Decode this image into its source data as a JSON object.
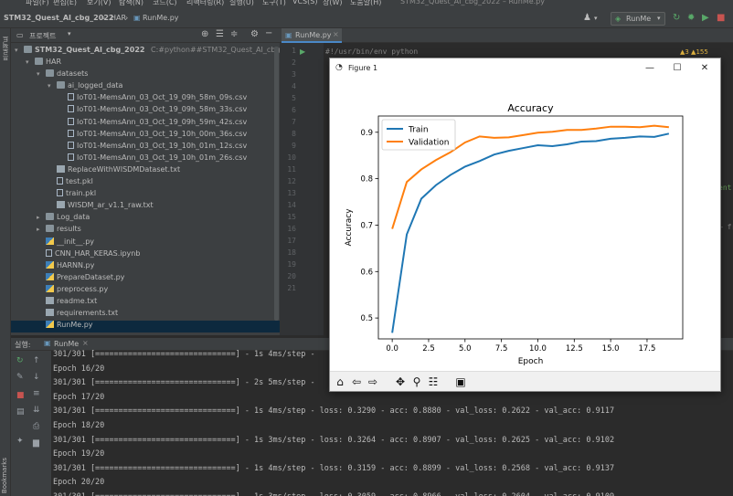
{
  "menu": [
    "파일(F)",
    "편집(E)",
    "보기(V)",
    "탐색(N)",
    "코드(C)",
    "리팩터링(R)",
    "실행(U)",
    "도구(T)",
    "VCS(S)",
    "창(W)",
    "도움말(H)",
    "STM32_Quest_AI_cbg_2022 – RunMe.py"
  ],
  "breadcrumb": {
    "project": "STM32_Quest_AI_cbg_2022",
    "folder": "HAR",
    "file": "RunMe.py"
  },
  "run_config": "RunMe",
  "project_panel": {
    "title": "프로젝트",
    "root": "STM32_Quest_AI_cbg_2022",
    "root_path": "C:#python##STM32_Quest_AI_cbg_2022",
    "items": [
      {
        "label": "HAR",
        "type": "folder",
        "expanded": true,
        "depth": 1
      },
      {
        "label": "datasets",
        "type": "folder",
        "expanded": true,
        "depth": 2
      },
      {
        "label": "ai_logged_data",
        "type": "folder",
        "expanded": true,
        "depth": 3
      },
      {
        "label": "IoT01-MemsAnn_03_Oct_19_09h_58m_09s.csv",
        "type": "file",
        "depth": 4
      },
      {
        "label": "IoT01-MemsAnn_03_Oct_19_09h_58m_33s.csv",
        "type": "file",
        "depth": 4
      },
      {
        "label": "IoT01-MemsAnn_03_Oct_19_09h_59m_42s.csv",
        "type": "file",
        "depth": 4
      },
      {
        "label": "IoT01-MemsAnn_03_Oct_19_10h_00m_36s.csv",
        "type": "file",
        "depth": 4
      },
      {
        "label": "IoT01-MemsAnn_03_Oct_19_10h_01m_12s.csv",
        "type": "file",
        "depth": 4
      },
      {
        "label": "IoT01-MemsAnn_03_Oct_19_10h_01m_26s.csv",
        "type": "file",
        "depth": 4
      },
      {
        "label": "ReplaceWithWISDMDataset.txt",
        "type": "txt",
        "depth": 3
      },
      {
        "label": "test.pkl",
        "type": "file",
        "depth": 3
      },
      {
        "label": "train.pkl",
        "type": "file",
        "depth": 3
      },
      {
        "label": "WISDM_ar_v1.1_raw.txt",
        "type": "txt",
        "depth": 3
      },
      {
        "label": "Log_data",
        "type": "folder",
        "expanded": false,
        "depth": 2
      },
      {
        "label": "results",
        "type": "folder",
        "expanded": false,
        "depth": 2
      },
      {
        "label": "__init__.py",
        "type": "py",
        "depth": 2
      },
      {
        "label": "CNN_HAR_KERAS.ipynb",
        "type": "file",
        "depth": 2
      },
      {
        "label": "HARNN.py",
        "type": "py",
        "depth": 2
      },
      {
        "label": "PrepareDataset.py",
        "type": "py",
        "depth": 2
      },
      {
        "label": "preprocess.py",
        "type": "py",
        "depth": 2
      },
      {
        "label": "readme.txt",
        "type": "txt",
        "depth": 2
      },
      {
        "label": "requirements.txt",
        "type": "txt",
        "depth": 2
      },
      {
        "label": "RunMe.py",
        "type": "py",
        "depth": 2,
        "selected": true
      }
    ]
  },
  "editor": {
    "tab": "RunMe.py",
    "inspections": "▲3  ▲155",
    "line_numbers": [
      "1",
      "2",
      "3",
      "4",
      "5",
      "6",
      "7",
      "8",
      "9",
      "10",
      "11",
      "12",
      "13",
      "14",
      "15",
      "16",
      "17",
      "18",
      "19",
      "20",
      "21"
    ],
    "first_line": "#!/usr/bin/env python",
    "partial_right": [
      "ent",
      "— fr"
    ]
  },
  "run_panel": {
    "label": "실행:",
    "tab": "RunMe",
    "lines": [
      "301/301 [==============================] - 1s 4ms/step -",
      "Epoch 16/20",
      "301/301 [==============================] - 2s 5ms/step -",
      "Epoch 17/20",
      "301/301 [==============================] - 1s 4ms/step - loss: 0.3290 - acc: 0.8880 - val_loss: 0.2622 - val_acc: 0.9117",
      "Epoch 18/20",
      "301/301 [==============================] - 1s 3ms/step - loss: 0.3264 - acc: 0.8907 - val_loss: 0.2625 - val_acc: 0.9102",
      "Epoch 19/20",
      "301/301 [==============================] - 1s 4ms/step - loss: 0.3159 - acc: 0.8899 - val_loss: 0.2568 - val_acc: 0.9137",
      "Epoch 20/20",
      "301/301 [==============================] - 1s 3ms/step - loss: 0.3059 - acc: 0.8966 - val_loss: 0.2604 - val_acc: 0.9109"
    ]
  },
  "left_strip": {
    "project_label": "프로젝트",
    "bookmarks_label": "Bookmarks"
  },
  "figure": {
    "window_title": "Figure 1",
    "toolbar_icons": [
      "home-icon",
      "back-icon",
      "forward-icon",
      "pan-icon",
      "zoom-icon",
      "configure-icon",
      "save-icon"
    ]
  },
  "chart_data": {
    "type": "line",
    "title": "Accuracy",
    "xlabel": "Epoch",
    "ylabel": "Accuracy",
    "x": [
      0,
      1,
      2,
      3,
      4,
      5,
      6,
      7,
      8,
      9,
      10,
      11,
      12,
      13,
      14,
      15,
      16,
      17,
      18,
      19
    ],
    "xticks": [
      "0.0",
      "2.5",
      "5.0",
      "7.5",
      "10.0",
      "12.5",
      "15.0",
      "17.5"
    ],
    "xtick_values": [
      0,
      2.5,
      5,
      7.5,
      10,
      12.5,
      15,
      17.5
    ],
    "yticks": [
      "0.5",
      "0.6",
      "0.7",
      "0.8",
      "0.9"
    ],
    "ytick_values": [
      0.5,
      0.6,
      0.7,
      0.8,
      0.9
    ],
    "xlim": [
      -0.95,
      19.95
    ],
    "ylim": [
      0.455,
      0.935
    ],
    "legend_position": "top-left",
    "series": [
      {
        "name": "Train",
        "color": "#1f77b4",
        "values": [
          0.468,
          0.68,
          0.757,
          0.786,
          0.808,
          0.826,
          0.838,
          0.852,
          0.86,
          0.866,
          0.872,
          0.87,
          0.874,
          0.88,
          0.881,
          0.886,
          0.888,
          0.891,
          0.89,
          0.897
        ]
      },
      {
        "name": "Validation",
        "color": "#ff7f0e",
        "values": [
          0.692,
          0.793,
          0.82,
          0.84,
          0.857,
          0.878,
          0.891,
          0.888,
          0.889,
          0.894,
          0.899,
          0.901,
          0.905,
          0.905,
          0.908,
          0.912,
          0.912,
          0.911,
          0.914,
          0.911
        ]
      }
    ]
  }
}
